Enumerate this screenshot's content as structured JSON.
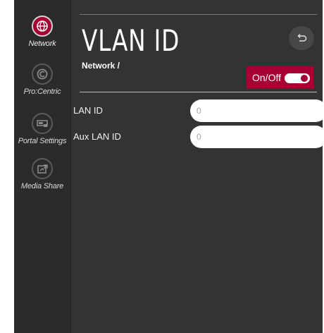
{
  "sidebar": {
    "items": [
      {
        "label": "Network",
        "icon": "network-globe-icon",
        "active": true
      },
      {
        "label": "Pro:Centric",
        "icon": "procentric-icon",
        "active": false
      },
      {
        "label": "Portal Settings",
        "icon": "portal-settings-icon",
        "active": false
      },
      {
        "label": "Media Share",
        "icon": "media-share-icon",
        "active": false
      }
    ]
  },
  "header": {
    "title": "VLAN ID",
    "breadcrumb": "Network /",
    "back_icon": "back-arrow-icon"
  },
  "toggle": {
    "label": "On/Off",
    "state": "on"
  },
  "fields": [
    {
      "label": "LAN ID",
      "placeholder": "0"
    },
    {
      "label": "Aux LAN ID",
      "placeholder": "0"
    }
  ],
  "colors": {
    "accent": "#a50034",
    "panel": "#333333",
    "sidebar": "#2b2b2b"
  }
}
